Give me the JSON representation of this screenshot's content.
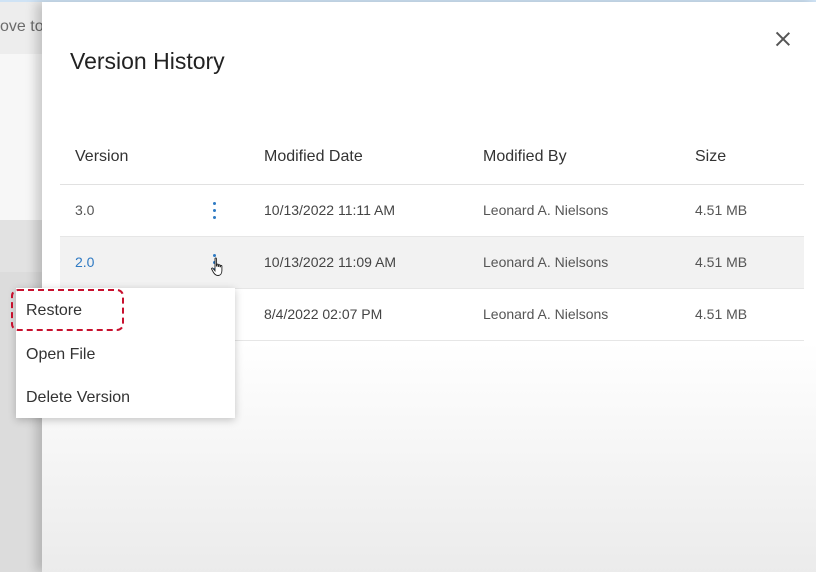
{
  "background": {
    "partial_text": "ove to"
  },
  "panel": {
    "title": "Version History",
    "close_icon": "close-icon"
  },
  "table": {
    "headers": {
      "version": "Version",
      "modified_date": "Modified Date",
      "modified_by": "Modified By",
      "size": "Size"
    },
    "rows": [
      {
        "version": "3.0",
        "modified_date": "10/13/2022 11:11 AM",
        "modified_by": "Leonard A. Nielsons",
        "size": "4.51 MB",
        "selected": false
      },
      {
        "version": "2.0",
        "modified_date": "10/13/2022 11:09 AM",
        "modified_by": "Leonard A. Nielsons",
        "size": "4.51 MB",
        "selected": true
      },
      {
        "version": "",
        "modified_date": "8/4/2022 02:07 PM",
        "modified_by": "Leonard A. Nielsons",
        "size": "4.51 MB",
        "selected": false
      }
    ]
  },
  "context_menu": {
    "items": [
      "Restore",
      "Open File",
      "Delete Version"
    ],
    "highlighted_item": "Restore"
  },
  "colors": {
    "link_blue": "#2f7ac3",
    "highlight_red": "#c8102e"
  }
}
